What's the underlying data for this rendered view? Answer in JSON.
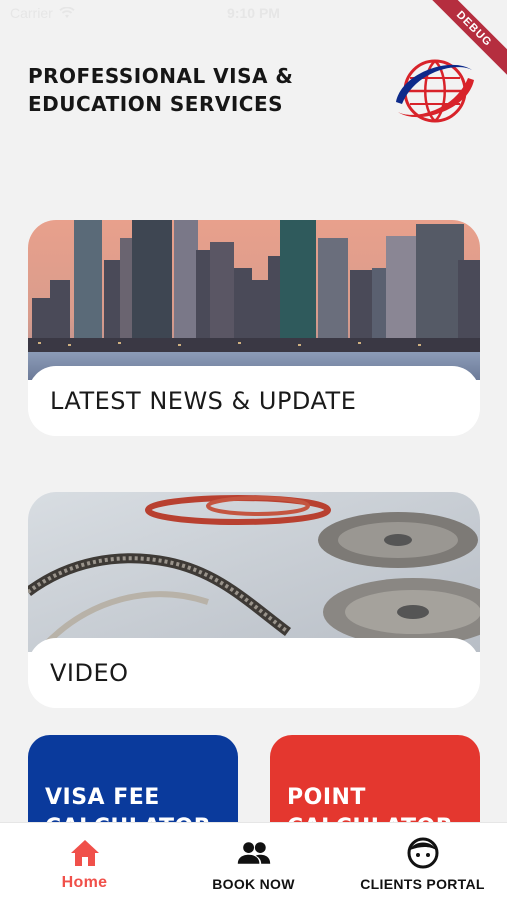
{
  "status_bar": {
    "carrier": "Carrier",
    "time": "9:10 PM"
  },
  "debug_banner": "DEBUG",
  "header": {
    "title_line1": "PROFESSIONAL VISA &",
    "title_line2": "EDUCATION SERVICES"
  },
  "cards": {
    "news": {
      "label": "LATEST NEWS & UPDATE"
    },
    "video": {
      "label": "VIDEO"
    }
  },
  "tiles": {
    "visa_fee": {
      "label": "VISA FEE CALCULATOR"
    },
    "point": {
      "label": "POINT CALCULATOR"
    }
  },
  "bottom_nav": {
    "items": [
      {
        "label": "Home",
        "icon": "home-icon",
        "active": true
      },
      {
        "label": "BOOK NOW",
        "icon": "people-icon",
        "active": false
      },
      {
        "label": "CLIENTS PORTAL",
        "icon": "face-icon",
        "active": false
      }
    ]
  },
  "colors": {
    "accent_active": "#f0504a",
    "tile_blue": "#0a3a9c",
    "tile_red": "#e4372f",
    "debug": "#b52e3f"
  }
}
